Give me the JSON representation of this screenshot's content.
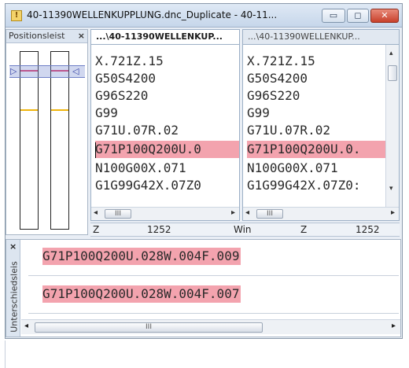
{
  "window": {
    "title": "40-11390WELLENKUPPLUNG.dnc_Duplicate - 40-11...",
    "title_icon": "!",
    "min_label": "▭",
    "max_label": "◻",
    "close_label": "✕"
  },
  "positions_panel": {
    "title": "Positionsleist",
    "close_label": "×",
    "arrow_left": "▷",
    "arrow_right": "◁"
  },
  "editor_left": {
    "tab": "...\\40-11390WELLENKUP...",
    "lines": [
      "X.721Z.15",
      "G50S4200",
      "G96S220",
      "G99",
      "G71U.07R.02",
      "G71P100Q200U.0",
      "N100G00X.071",
      "G1G99G42X.07Z0"
    ],
    "highlighted_index": 5
  },
  "editor_right": {
    "tab": "...\\40-11390WELLENKUP...",
    "lines": [
      "X.721Z.15",
      "G50S4200",
      "G96S220",
      "G99",
      "G71U.07R.02",
      "G71P100Q200U.0.",
      "N100G00X.071",
      "G1G99G42X.07Z0:"
    ],
    "highlighted_index": 5
  },
  "scroll": {
    "left_arrow": "◂",
    "right_arrow": "▸",
    "up_arrow": "▴",
    "down_arrow": "▾",
    "thumb_grip": "III"
  },
  "statusbar": {
    "left_label": "Z",
    "left_value": "1252",
    "mid_label": "Win",
    "right_label": "Z",
    "right_value": "1252"
  },
  "diff_panel": {
    "title": "Unterschiedsleis",
    "close_label": "×",
    "line1": "G71P100Q200U.028W.004F.009",
    "line2": "G71P100Q200U.028W.004F.007"
  },
  "colors": {
    "highlight": "#f3a3ae",
    "position_red": "#e03b6a",
    "position_yellow": "#efb40d"
  }
}
